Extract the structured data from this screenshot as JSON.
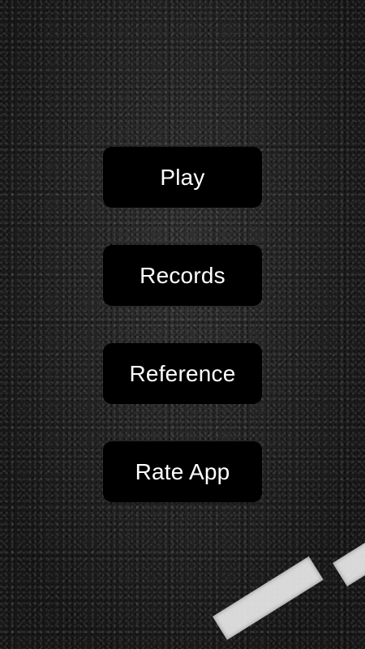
{
  "menu": {
    "items": [
      {
        "label": "Play"
      },
      {
        "label": "Records"
      },
      {
        "label": "Reference"
      },
      {
        "label": "Rate App"
      }
    ]
  },
  "colors": {
    "button_background": "#000000",
    "button_text": "#ffffff",
    "road_marking": "#e9e9e9"
  }
}
